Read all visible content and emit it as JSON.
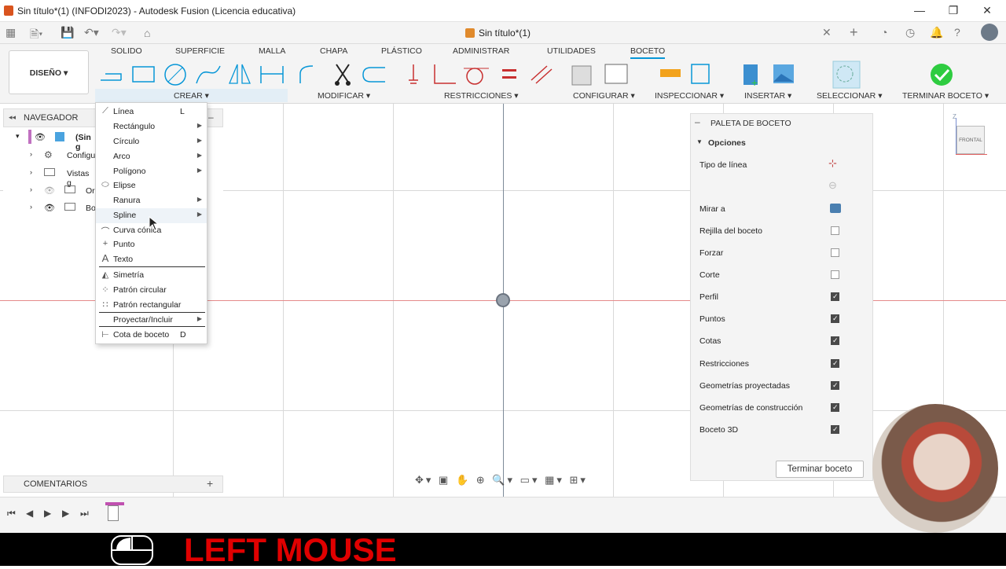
{
  "window": {
    "title": "Sin título*(1) (INFODI2023) - Autodesk Fusion (Licencia educativa)"
  },
  "document_tab": {
    "label": "Sin título*(1)"
  },
  "workspace": {
    "label": "DISEÑO"
  },
  "ribbon_tabs": [
    {
      "label": "SOLIDO"
    },
    {
      "label": "SUPERFICIE"
    },
    {
      "label": "MALLA"
    },
    {
      "label": "CHAPA"
    },
    {
      "label": "PLÁSTICO"
    },
    {
      "label": "ADMINISTRAR"
    },
    {
      "label": "UTILIDADES"
    },
    {
      "label": "BOCETO"
    }
  ],
  "ribbon_groups": [
    {
      "label": "CREAR"
    },
    {
      "label": "MODIFICAR"
    },
    {
      "label": "RESTRICCIONES"
    },
    {
      "label": "CONFIGURAR"
    },
    {
      "label": "INSPECCIONAR"
    },
    {
      "label": "INSERTAR"
    },
    {
      "label": "SELECCIONAR"
    },
    {
      "label": "TERMINAR BOCETO"
    }
  ],
  "navigator": {
    "title": "NAVEGADOR",
    "items": [
      {
        "label": "(Sin g"
      },
      {
        "label": "Configu"
      },
      {
        "label": "Vistas g"
      },
      {
        "label": "Or"
      },
      {
        "label": "Bo"
      }
    ]
  },
  "create_menu": {
    "items": [
      {
        "label": "Línea",
        "shortcut": "L"
      },
      {
        "label": "Rectángulo"
      },
      {
        "label": "Círculo"
      },
      {
        "label": "Arco"
      },
      {
        "label": "Polígono"
      },
      {
        "label": "Elipse"
      },
      {
        "label": "Ranura"
      },
      {
        "label": "Spline"
      },
      {
        "label": "Curva cónica"
      },
      {
        "label": "Punto"
      },
      {
        "label": "Texto"
      },
      {
        "label": "Simetría"
      },
      {
        "label": "Patrón circular"
      },
      {
        "label": "Patrón rectangular"
      },
      {
        "label": "Proyectar/Incluir"
      },
      {
        "label": "Cota de boceto",
        "shortcut": "D"
      }
    ]
  },
  "palette": {
    "title": "PALETA DE BOCETO",
    "section": "Opciones",
    "rows": [
      {
        "label": "Tipo de línea"
      },
      {
        "label": "Mirar a"
      },
      {
        "label": "Rejilla del boceto",
        "checked": false
      },
      {
        "label": "Forzar",
        "checked": false
      },
      {
        "label": "Corte",
        "checked": false
      },
      {
        "label": "Perfil",
        "checked": true
      },
      {
        "label": "Puntos",
        "checked": true
      },
      {
        "label": "Cotas",
        "checked": true
      },
      {
        "label": "Restricciones",
        "checked": true
      },
      {
        "label": "Geometrías proyectadas",
        "checked": true
      },
      {
        "label": "Geometrías de construcción",
        "checked": true
      },
      {
        "label": "Boceto 3D",
        "checked": true
      }
    ],
    "finish_button": "Terminar boceto"
  },
  "viewcube": {
    "face": "FRONTAL",
    "axis_z": "Z"
  },
  "comments": {
    "title": "COMENTARIOS"
  },
  "overlay": {
    "text": "LEFT MOUSE"
  },
  "colors": {
    "accent": "#0696d7",
    "finish_green": "#2ecc40",
    "overlay_red": "#e00000"
  }
}
